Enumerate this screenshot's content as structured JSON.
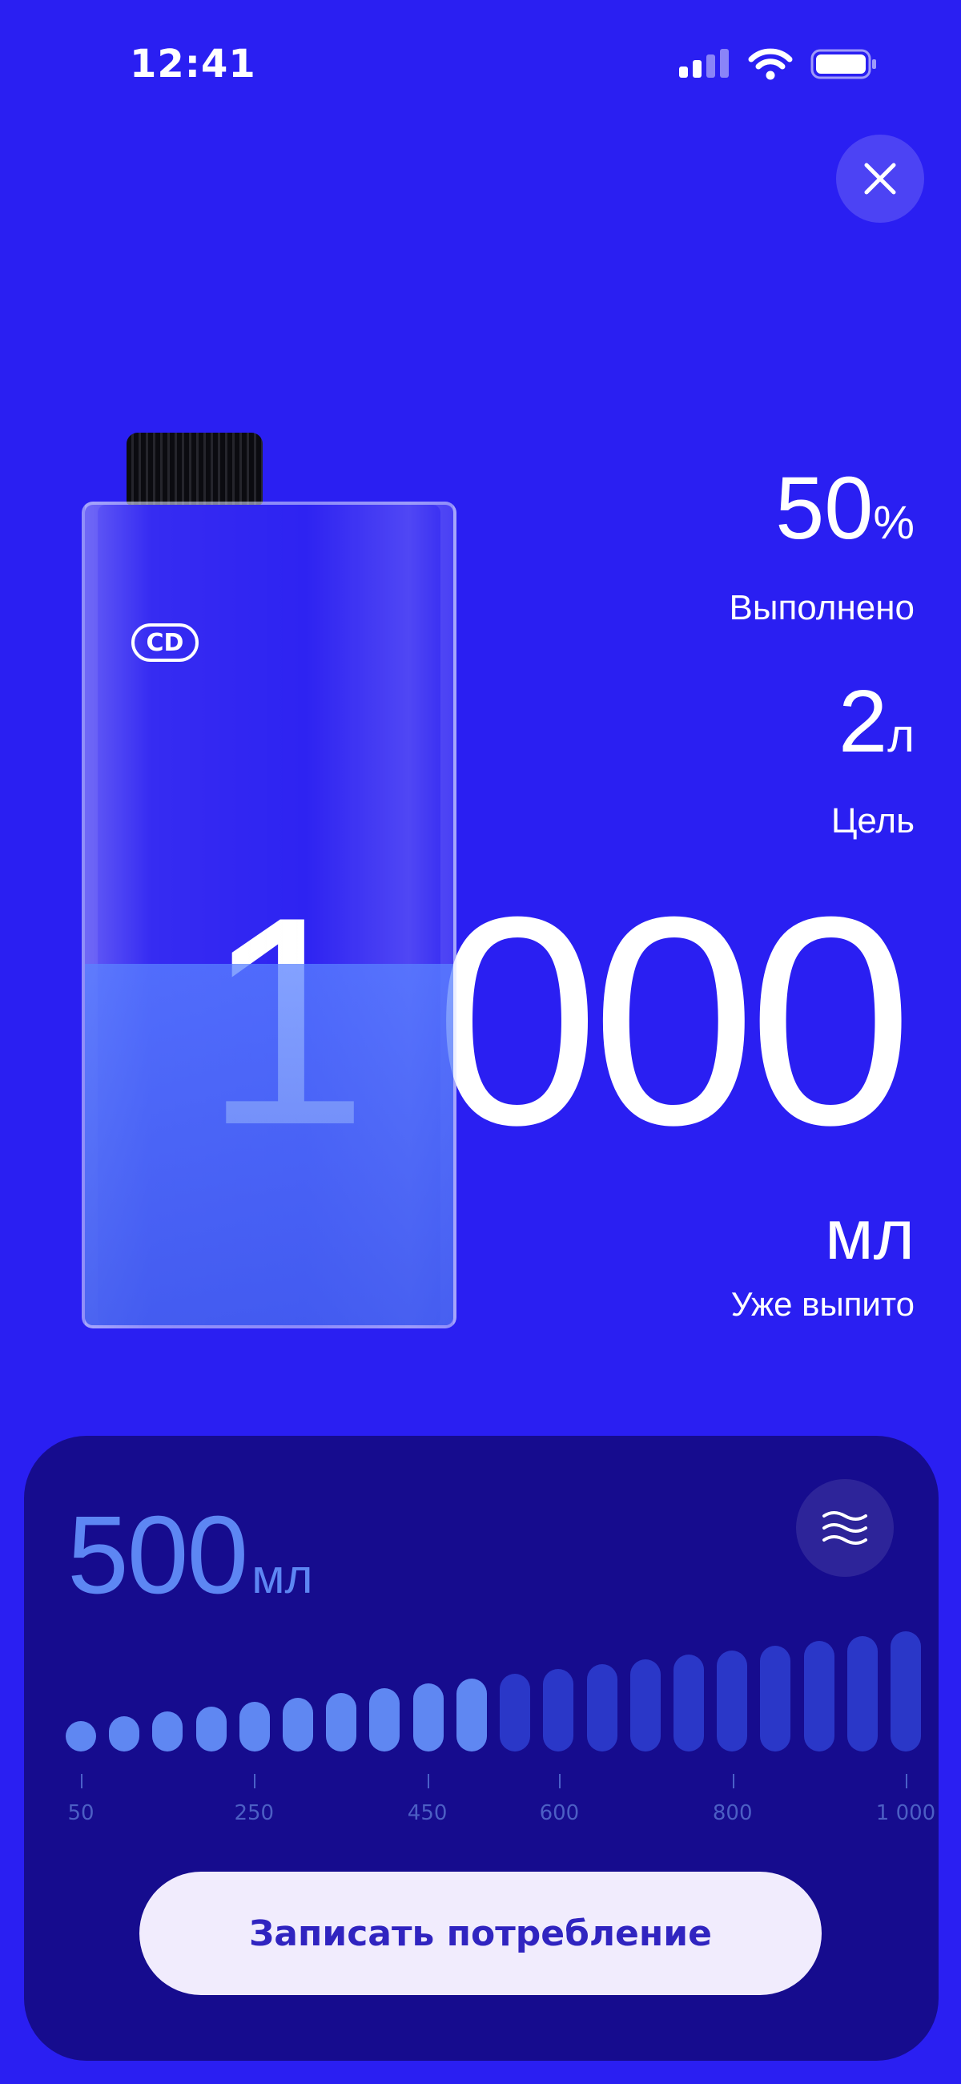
{
  "status_bar": {
    "time": "12:41"
  },
  "progress": {
    "value": "50",
    "unit": "%",
    "label": "Выполнено",
    "fraction": 0.5
  },
  "goal": {
    "value": "2",
    "unit": "л",
    "label": "Цель"
  },
  "drunk": {
    "value": "1 000",
    "unit": "мл",
    "label": "Уже выпито"
  },
  "bottle": {
    "logo": "CD",
    "fill_fraction": 0.44
  },
  "picker": {
    "amount": "500",
    "unit": "мл",
    "selected_index": 9,
    "bar_count": 20,
    "tick_labels": [
      "50",
      "250",
      "450",
      "600",
      "800",
      "1 000"
    ],
    "record_button": "Записать потребление"
  },
  "colors": {
    "background": "#2a1ff2",
    "panel": "#160c8e",
    "bar_active": "#5f87f2",
    "bar_inactive": "#2a37c8",
    "button_text": "#3024c0"
  }
}
